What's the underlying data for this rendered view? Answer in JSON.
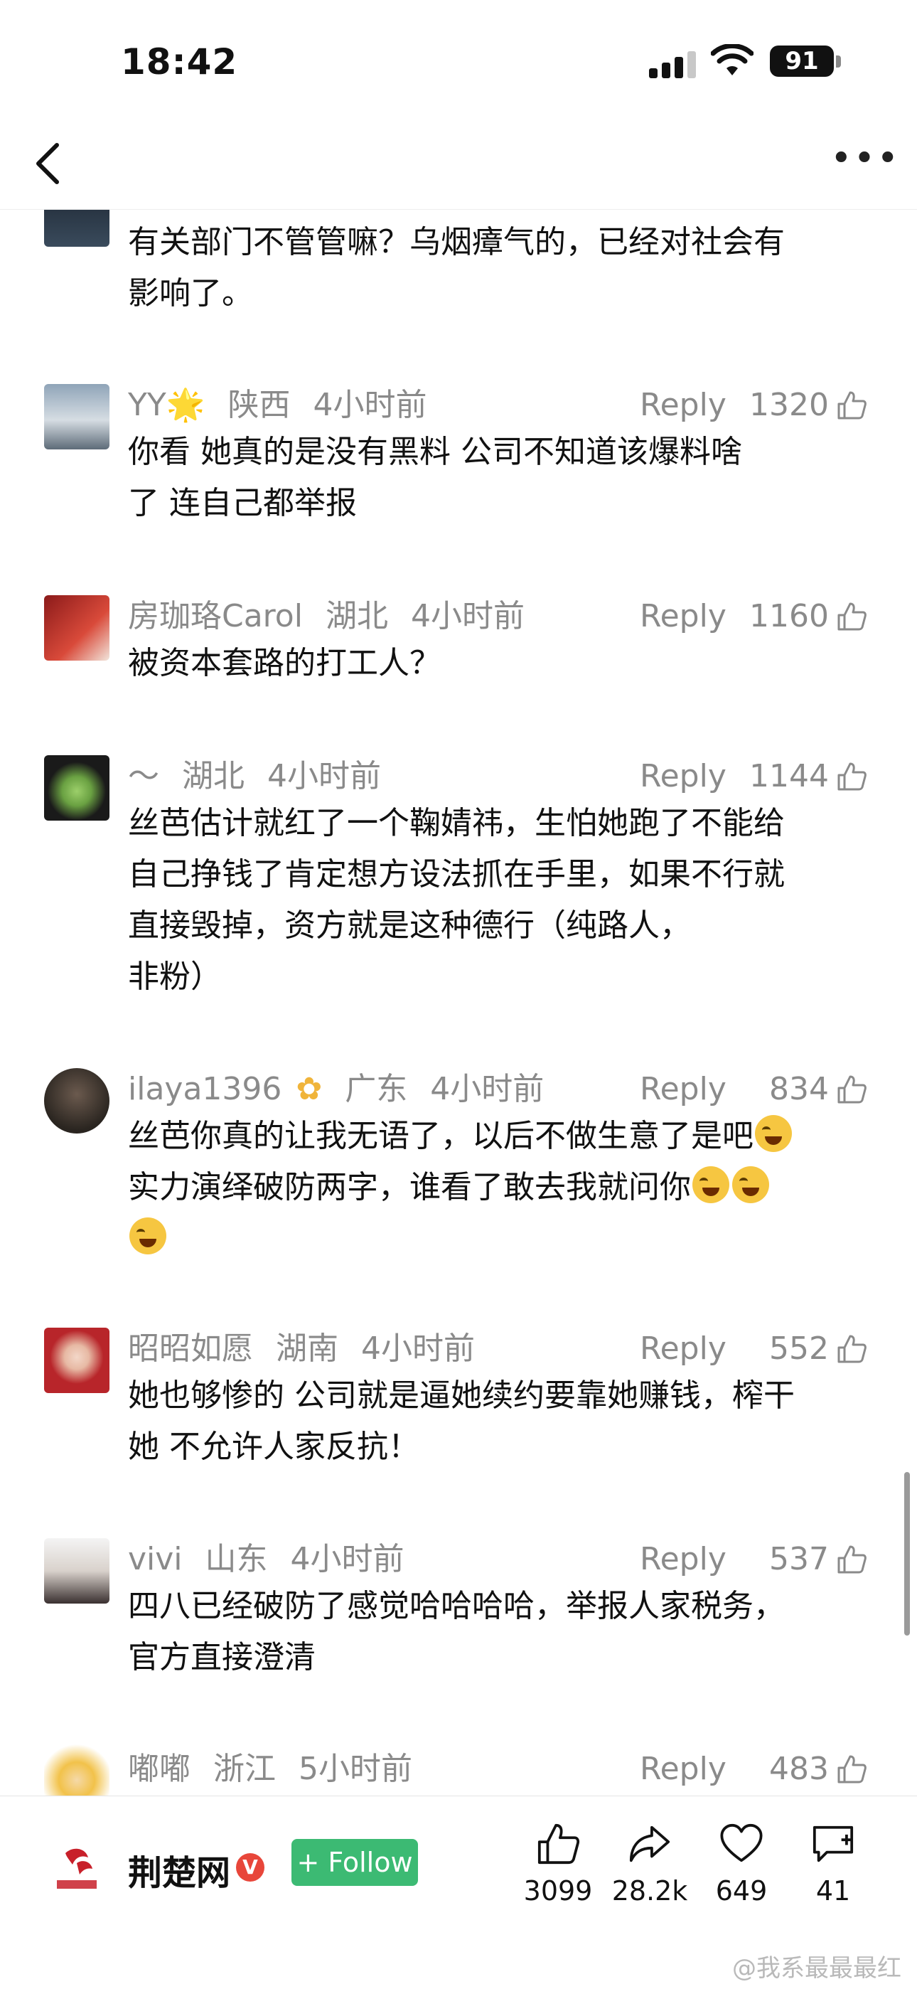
{
  "status_bar": {
    "time": "18:42",
    "battery": "91"
  },
  "nav": {
    "back_icon": "chevron-left-icon",
    "more_icon": "ellipsis-icon"
  },
  "comments": [
    {
      "user": "",
      "location": "",
      "time": "",
      "reply": "",
      "likes": "",
      "text": [
        "有关部门不管管嘛？乌烟瘴气的，已经对社会有",
        "影响了。"
      ]
    },
    {
      "user": "YY🌟",
      "location": "陕西",
      "time": "4小时前",
      "reply": "Reply",
      "likes": "1320",
      "text": [
        "你看 她真的是没有黑料 公司不知道该爆料啥",
        "了 连自己都举报"
      ]
    },
    {
      "user": "房珈珞Carol",
      "location": "湖北",
      "time": "4小时前",
      "reply": "Reply",
      "likes": "1160",
      "text": [
        "被资本套路的打工人？"
      ]
    },
    {
      "user": "～",
      "location": "湖北",
      "time": "4小时前",
      "reply": "Reply",
      "likes": "1144",
      "text": [
        "丝芭估计就红了一个鞠婧祎，生怕她跑了不能给",
        "自己挣钱了肯定想方设法抓在手里，如果不行就",
        "直接毁掉，资方就是这种德行（纯路人，",
        "非粉）"
      ]
    },
    {
      "user": "ilaya1396",
      "location": "广东",
      "time": "4小时前",
      "reply": "Reply",
      "likes": "834",
      "text": [
        "丝芭你真的让我无语了，以后不做生意了是吧",
        "实力演绎破防两字，谁看了敢去我就问你",
        ""
      ]
    },
    {
      "user": "昭昭如愿",
      "location": "湖南",
      "time": "4小时前",
      "reply": "Reply",
      "likes": "552",
      "text": [
        "她也够惨的 公司就是逼她续约要靠她赚钱，榨干",
        "她 不允许人家反抗！"
      ]
    },
    {
      "user": "vivi",
      "location": "山东",
      "time": "4小时前",
      "reply": "Reply",
      "likes": "537",
      "text": [
        "四八已经破防了感觉哈哈哈哈，举报人家税务，",
        "官方直接澄清"
      ]
    },
    {
      "user": "嘟嘟",
      "location": "浙江",
      "time": "5小时前",
      "reply": "Reply",
      "likes": "483",
      "text": []
    }
  ],
  "bottom_bar": {
    "publisher": "荆楚网",
    "verified_badge": "V",
    "follow_label": "+ Follow",
    "actions": [
      {
        "icon": "thumbs-up-icon",
        "count": "3099"
      },
      {
        "icon": "share-icon",
        "count": "28.2k"
      },
      {
        "icon": "heart-icon",
        "count": "649"
      },
      {
        "icon": "comment-add-icon",
        "count": "41"
      }
    ]
  },
  "watermark": "@我系最最最红",
  "colors": {
    "follow_green": "#3cba73",
    "meta_gray": "#8a8a8a",
    "verified_red": "#e8463a"
  }
}
